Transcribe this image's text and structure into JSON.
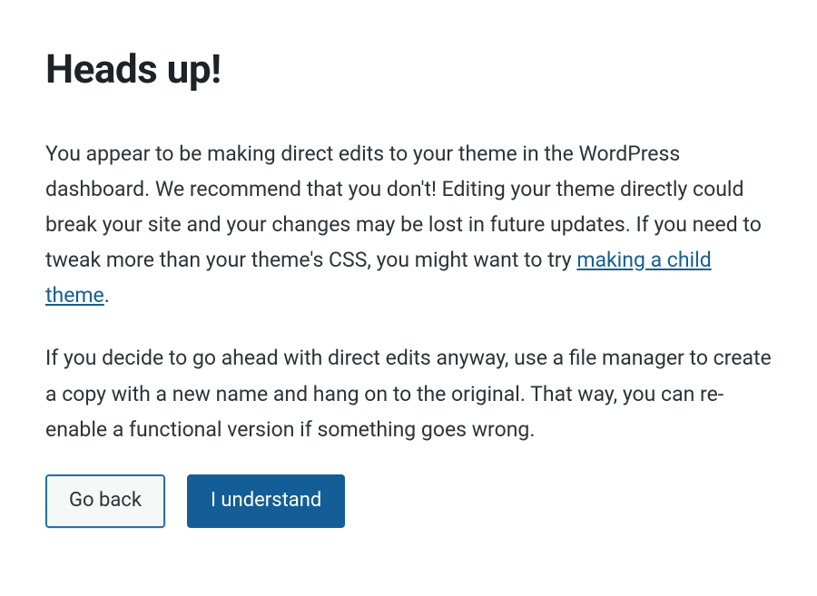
{
  "dialog": {
    "heading": "Heads up!",
    "paragraph1_before_link": "You appear to be making direct edits to your theme in the WordPress dashboard. We recommend that you don't! Editing your theme directly could break your site and your changes may be lost in future updates. If you need to tweak more than your theme's CSS, you might want to try ",
    "link_text": "making a child theme",
    "paragraph1_after_link": ".",
    "paragraph2": "If you decide to go ahead with direct edits anyway, use a file manager to create a copy with a new name and hang on to the original. That way, you can re-enable a functional version if something goes wrong.",
    "buttons": {
      "go_back": "Go back",
      "i_understand": "I understand"
    }
  }
}
